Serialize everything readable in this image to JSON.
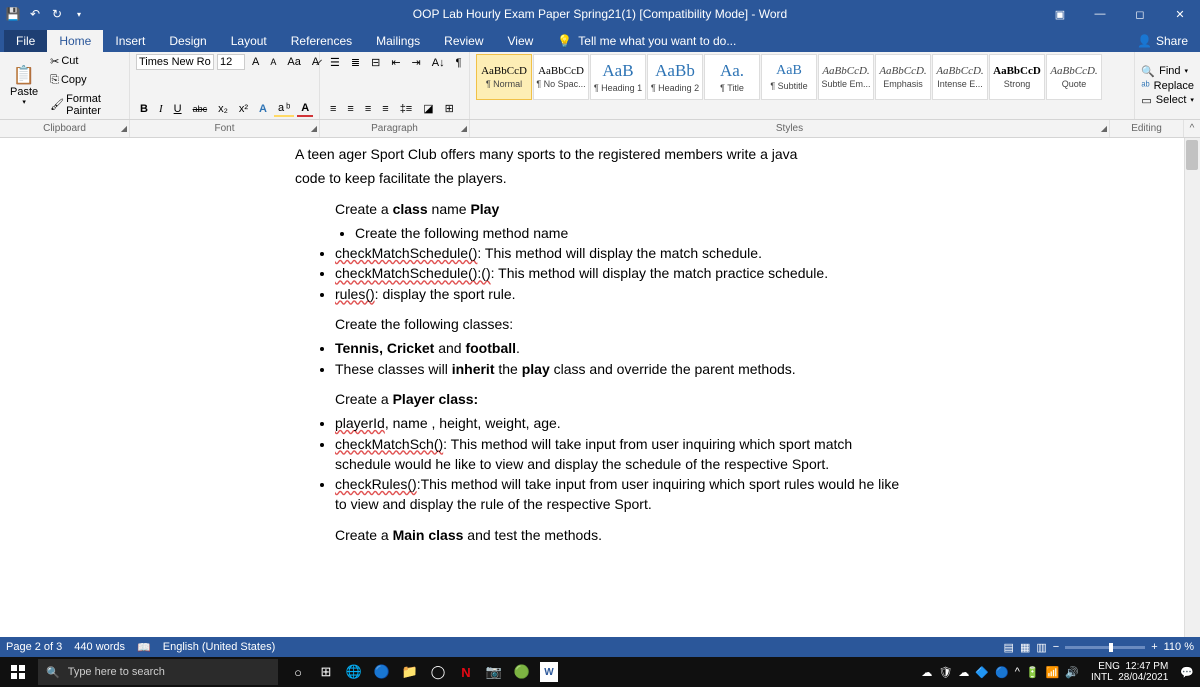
{
  "titlebar": {
    "title": "OOP Lab Hourly Exam Paper Spring21(1) [Compatibility Mode] - Word"
  },
  "tabs": {
    "file": "File",
    "home": "Home",
    "insert": "Insert",
    "design": "Design",
    "layout": "Layout",
    "references": "References",
    "mailings": "Mailings",
    "review": "Review",
    "view": "View",
    "tellme": "Tell me what you want to do...",
    "share": "Share"
  },
  "clipboard": {
    "paste": "Paste",
    "cut": "Cut",
    "copy": "Copy",
    "fmt": "Format Painter",
    "label": "Clipboard"
  },
  "font": {
    "name": "Times New Ro",
    "size": "12",
    "B": "B",
    "I": "I",
    "U": "U",
    "abc": "abc",
    "x2": "x₂",
    "x2sup": "x²",
    "Aa": "Aa",
    "label": "Font"
  },
  "paragraph": {
    "label": "Paragraph"
  },
  "styles": {
    "label": "Styles",
    "items": [
      {
        "sample": "AaBbCcD",
        "name": "¶ Normal",
        "cls": "small"
      },
      {
        "sample": "AaBbCcD",
        "name": "¶ No Spac...",
        "cls": "small"
      },
      {
        "sample": "AaB",
        "name": "¶ Heading 1",
        "cls": "big"
      },
      {
        "sample": "AaBb",
        "name": "¶ Heading 2",
        "cls": "big"
      },
      {
        "sample": "Aa.",
        "name": "¶ Title",
        "cls": "big"
      },
      {
        "sample": "AaB",
        "name": "¶ Subtitle",
        "cls": "med"
      },
      {
        "sample": "AaBbCcD.",
        "name": "Subtle Em...",
        "cls": "italic"
      },
      {
        "sample": "AaBbCcD.",
        "name": "Emphasis",
        "cls": "italic"
      },
      {
        "sample": "AaBbCcD.",
        "name": "Intense E...",
        "cls": "italic"
      },
      {
        "sample": "AaBbCcD",
        "name": "Strong",
        "cls": "bold"
      },
      {
        "sample": "AaBbCcD.",
        "name": "Quote",
        "cls": "italic"
      }
    ]
  },
  "editing": {
    "find": "Find",
    "replace": "Replace",
    "select": "Select",
    "label": "Editing"
  },
  "doc": {
    "intro1": "A teen ager Sport Club offers many sports to the registered members write a java",
    "intro2": "code to keep facilitate the players.",
    "h1a": "Create a ",
    "h1b": "class",
    "h1c": " name ",
    "h1d": "Play",
    "b1": "Create the following method name",
    "m1a": "checkMatchSchedule()",
    "m1b": ": This method will display the match schedule.",
    "m2a": "checkMatchSchedule():()",
    "m2b": ": This method will display the match practice schedule.",
    "m3a": "rules()",
    "m3b": ": display the sport rule.",
    "h2": "Create the following classes:",
    "c1a": "Tennis, Cricket",
    "c1b": " and ",
    "c1c": "football",
    "c1d": ".",
    "c2a": "These classes will ",
    "c2b": "inherit",
    "c2c": " the ",
    "c2d": "play",
    "c2e": " class and override the parent methods.",
    "h3a": "Create a ",
    "h3b": "Player class:",
    "p1a": "playerId",
    "p1b": ", name , height, weight, age.",
    "p2a": "checkMatchSch()",
    "p2b": ": This method will take input from user inquiring which sport match schedule would he like to view and display the schedule of the respective Sport.",
    "p3a": "checkRules()",
    "p3b": ":This method will take input from user inquiring which sport rules would he like to view and display the rule of the respective Sport.",
    "h4a": "Create a ",
    "h4b": "Main class",
    "h4c": " and test the methods."
  },
  "status": {
    "page": "Page 2 of 3",
    "words": "440 words",
    "lang": "English (United States)",
    "zoom": "110 %"
  },
  "taskbar": {
    "search": "Type here to search",
    "lang": "ENG",
    "intl": "INTL",
    "time": "12:47 PM",
    "date": "28/04/2021"
  }
}
